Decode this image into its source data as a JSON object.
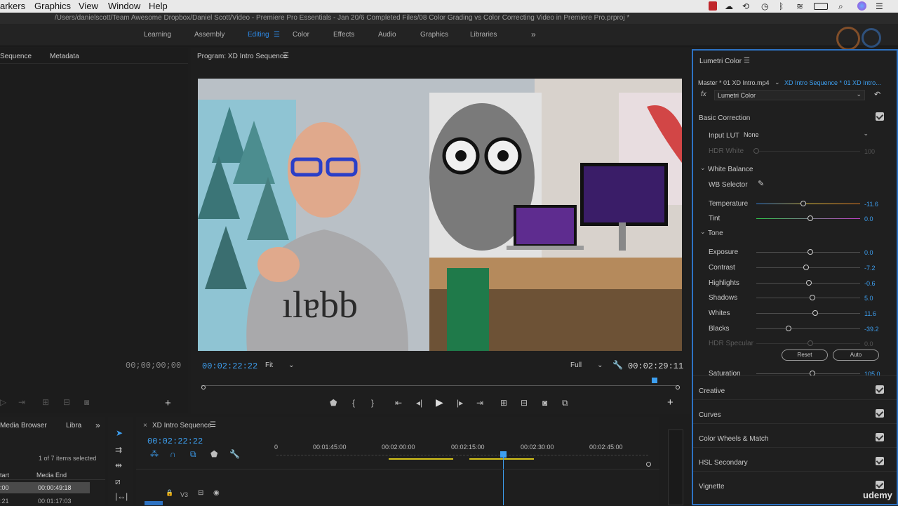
{
  "menubar": {
    "items": [
      "arkers",
      "Graphics",
      "View",
      "Window",
      "Help"
    ]
  },
  "titlebar": {
    "path": "/Users/danielscott/Team Awesome Dropbox/Daniel Scott/Video - Premiere Pro Essentials - Jan 20/6 Completed Files/08 Color Grading vs Color Correcting Video in Premiere Pro.prproj *"
  },
  "workspaces": {
    "tabs": [
      "Learning",
      "Assembly",
      "Editing",
      "Color",
      "Effects",
      "Audio",
      "Graphics",
      "Libraries"
    ],
    "active": "Editing",
    "more": "»"
  },
  "left_panel": {
    "tab_sequence": "Sequence",
    "tab_metadata": "Metadata",
    "timecode": "00;00;00;00"
  },
  "program": {
    "title": "Program: XD Intro Sequence",
    "current_tc": "00:02:22:22",
    "fit": "Fit",
    "quality": "Full",
    "duration_tc": "00:02:29:11",
    "playhead_fraction": 0.95
  },
  "project_panel": {
    "tab_media_browser": "Media Browser",
    "tab_libra": "Libra",
    "selection": "1 of 7 items selected",
    "col_start": "tart",
    "col_media_end": "Media End",
    "rows": [
      {
        "start": ":00",
        "end": "00:00:49:18"
      },
      {
        "start": ":21",
        "end": "00:01:17:03"
      }
    ]
  },
  "timeline": {
    "seq_name": "XD Intro Sequence",
    "timecode": "00:02:22:22",
    "ticks": [
      "0",
      "00:01:45:00",
      "00:02:00:00",
      "00:02:15:00",
      "00:02:30:00",
      "00:02:45:00"
    ],
    "track_label": "V3"
  },
  "lumetri": {
    "title": "Lumetri Color",
    "master": "Master * 01 XD Intro.mp4",
    "sequence_clip": "XD Intro Sequence * 01 XD Intro...",
    "fx_label": "fx",
    "fx_effect": "Lumetri Color",
    "basic_correction": "Basic Correction",
    "input_lut_label": "Input LUT",
    "input_lut_value": "None",
    "hdr_white_label": "HDR White",
    "hdr_white_value": "100",
    "white_balance": "White Balance",
    "wb_selector": "WB Selector",
    "tone": "Tone",
    "sliders": [
      {
        "label": "Temperature",
        "value": "-11.6",
        "pos": 0.45
      },
      {
        "label": "Tint",
        "value": "0.0",
        "pos": 0.52
      },
      {
        "label": "Exposure",
        "value": "0.0",
        "pos": 0.52
      },
      {
        "label": "Contrast",
        "value": "-7.2",
        "pos": 0.48
      },
      {
        "label": "Highlights",
        "value": "-0.6",
        "pos": 0.51
      },
      {
        "label": "Shadows",
        "value": "5.0",
        "pos": 0.54
      },
      {
        "label": "Whites",
        "value": "11.6",
        "pos": 0.57
      },
      {
        "label": "Blacks",
        "value": "-39.2",
        "pos": 0.31
      },
      {
        "label": "HDR Specular",
        "value": "0.0",
        "pos": 0.52
      },
      {
        "label": "Saturation",
        "value": "105.0",
        "pos": 0.54
      }
    ],
    "reset_label": "Reset",
    "auto_label": "Auto",
    "sections": [
      "Creative",
      "Curves",
      "Color Wheels & Match",
      "HSL Secondary",
      "Vignette"
    ]
  },
  "watermark": "udemy",
  "colors": {
    "accent": "#2d8ceb",
    "panel_border": "#2d72c2"
  }
}
